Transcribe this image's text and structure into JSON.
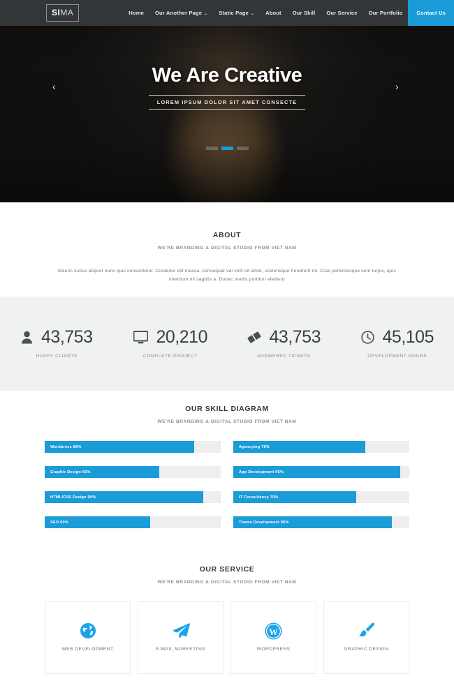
{
  "header": {
    "logo": {
      "bold": "SI",
      "light": "MA"
    },
    "nav": [
      {
        "label": "Home",
        "caret": false,
        "active": false
      },
      {
        "label": "Our Another Page",
        "caret": true,
        "active": false
      },
      {
        "label": "Static Page",
        "caret": true,
        "active": false
      },
      {
        "label": "About",
        "caret": false,
        "active": false
      },
      {
        "label": "Our Skill",
        "caret": false,
        "active": false
      },
      {
        "label": "Our Service",
        "caret": false,
        "active": false
      },
      {
        "label": "Our Portfolio",
        "caret": false,
        "active": false
      },
      {
        "label": "Contact Us",
        "caret": false,
        "active": true
      }
    ],
    "caret_glyph": "⌄",
    "accent_color": "#1b9bd8",
    "background_color": "#333639"
  },
  "hero": {
    "title": "We Are Creative",
    "subtitle": "LOREM IPSUM DOLOR SIT AMET CONSECTE",
    "prev_glyph": "‹",
    "next_glyph": "›",
    "slides": 3,
    "active_slide": 2
  },
  "about": {
    "title": "ABOUT",
    "subtitle": "WE'RE BRANDING & DIGITAL STUDIO FROM VIET NAM",
    "body": "Mauris luctus aliquet nunc quis consectetur. Curabitur elit massa, consequat vel velit sit amet, scelerisque hendrerit mi. Cras pellentesque sem turpis, quis interdum mi sagittis a. Donec mattis porttitor eleifend"
  },
  "counters": {
    "background_color": "#f0f1f1",
    "items": [
      {
        "icon": "user-icon",
        "value": "43,753",
        "label": "HAPPY CLIENTS"
      },
      {
        "icon": "monitor-icon",
        "value": "20,210",
        "label": "COMPLETE PROJECT"
      },
      {
        "icon": "ticket-icon",
        "value": "43,753",
        "label": "ANSWERED TICKETS"
      },
      {
        "icon": "clock-icon",
        "value": "45,105",
        "label": "DEVELOPMENT HOURS"
      }
    ]
  },
  "skills": {
    "title": "OUR SKILL DIAGRAM",
    "subtitle": "WE'RE BRANDING & DIGITAL STUDIO FROM VIET NAM",
    "bar_color": "#1b9bd8",
    "track_color": "#eeeeef",
    "items": [
      {
        "label": "Wordpress 85%",
        "percent": 85
      },
      {
        "label": "Agencying 75%",
        "percent": 75
      },
      {
        "label": "Graphic Design 65%",
        "percent": 65
      },
      {
        "label": "App Development 95%",
        "percent": 95
      },
      {
        "label": "HTML/CSS Design 90%",
        "percent": 90
      },
      {
        "label": "IT Consultancy 70%",
        "percent": 70
      },
      {
        "label": "SEO 60%",
        "percent": 60
      },
      {
        "label": "Theme Development 90%",
        "percent": 90
      }
    ]
  },
  "services": {
    "title": "OUR SERVICE",
    "subtitle": "WE'RE BRANDING & DIGITAL STUDIO FROM VIET NAM",
    "icon_color": "#1ba3e8",
    "items": [
      {
        "icon": "globe-icon",
        "name": "WEB DEVELOPMENT"
      },
      {
        "icon": "paper-plane-icon",
        "name": "E-MAIL MARKETING"
      },
      {
        "icon": "wordpress-icon",
        "name": "WORDPRESS"
      },
      {
        "icon": "paint-brush-icon",
        "name": "GRAPHIC DESIGN"
      }
    ]
  }
}
